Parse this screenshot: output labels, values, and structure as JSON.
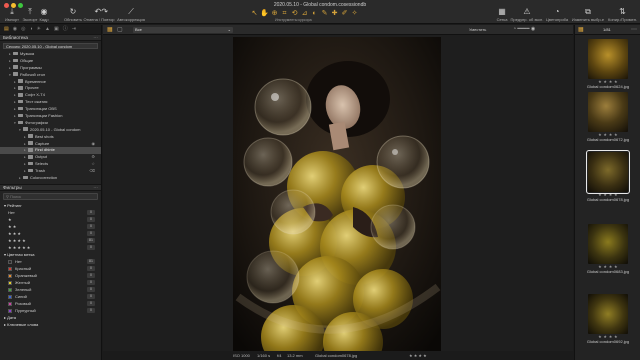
{
  "window": {
    "title": "2020.05.10 - Global condom.cosessiondb"
  },
  "toolbar": {
    "left": [
      {
        "label": "Импорт",
        "icon": "import-icon"
      },
      {
        "label": "Экспорт",
        "icon": "export-icon"
      },
      {
        "label": "Кадр",
        "icon": "camera-icon"
      },
      {
        "label": "Обновить",
        "icon": "refresh-icon"
      },
      {
        "label": "Отмена / Повтор",
        "icon": "undo-icon"
      },
      {
        "label": "Автокоррекция",
        "icon": "magic-wand-icon"
      }
    ],
    "cursor_tools_label": "Инструменты курсора",
    "right": [
      {
        "label": "Сетка",
        "icon": "grid-icon"
      },
      {
        "label": "Предупр. об эксп.",
        "icon": "exposure-warning-icon"
      },
      {
        "label": "Цветопроба",
        "icon": "proof-icon"
      },
      {
        "label": "Изменить выбр-е",
        "icon": "edit-selected-icon"
      },
      {
        "label": "Копир./Примен.",
        "icon": "copy-apply-icon"
      }
    ]
  },
  "left_panel": {
    "library_title": "Библиотека",
    "session_label": "Сессия: 2020.05.10 - Global condom",
    "tree": [
      {
        "label": "Музыка",
        "indent": 1
      },
      {
        "label": "Общие",
        "indent": 1
      },
      {
        "label": "Программы",
        "indent": 1
      },
      {
        "label": "Рабочий стол",
        "indent": 1,
        "open": true
      },
      {
        "label": "Временное",
        "indent": 2
      },
      {
        "label": "Прочее",
        "indent": 2
      },
      {
        "label": "Софт X-T4",
        "indent": 2
      },
      {
        "label": "Тест сжатия",
        "indent": 2
      },
      {
        "label": "Трансляции OBS",
        "indent": 2
      },
      {
        "label": "Трансляции Fashion",
        "indent": 2
      },
      {
        "label": "Фотографии",
        "indent": 2,
        "open": true
      },
      {
        "label": "2020.05.10 - Global condom",
        "indent": 3,
        "open": true
      },
      {
        "label": "Best shots",
        "indent": 4
      },
      {
        "label": "Capture",
        "indent": 4,
        "right_icon": "camera-icon"
      },
      {
        "label": "Find dhinte",
        "indent": 4,
        "selected": true
      },
      {
        "label": "Output",
        "indent": 4,
        "right_icon": "gear-icon"
      },
      {
        "label": "Selects",
        "indent": 4,
        "right_icon": "star-icon"
      },
      {
        "label": "Trash",
        "indent": 4,
        "right_icon": "trash-icon"
      },
      {
        "label": "Colorcorrection",
        "indent": 3
      }
    ],
    "filters_title": "Фильтры",
    "search_placeholder": "Поиск",
    "rating_title": "Рейтинг",
    "ratings": [
      {
        "label": "Нет",
        "count": "0"
      },
      {
        "label": "★",
        "count": "0"
      },
      {
        "label": "★ ★",
        "count": "0"
      },
      {
        "label": "★ ★ ★",
        "count": "0"
      },
      {
        "label": "★ ★ ★ ★",
        "count": "81"
      },
      {
        "label": "★ ★ ★ ★ ★",
        "count": "0"
      }
    ],
    "color_title": "Цветная метка",
    "color_labels": [
      {
        "label": "Нет",
        "count": "81",
        "color": "#2a2a2a"
      },
      {
        "label": "Красный",
        "count": "0",
        "color": "#d43a2f"
      },
      {
        "label": "Оранжевый",
        "count": "0",
        "color": "#e58a2a"
      },
      {
        "label": "Желтый",
        "count": "0",
        "color": "#e4cf2a"
      },
      {
        "label": "Зеленый",
        "count": "0",
        "color": "#3fae3a"
      },
      {
        "label": "Синий",
        "count": "0",
        "color": "#3a64d6"
      },
      {
        "label": "Розовый",
        "count": "0",
        "color": "#d23fa7"
      },
      {
        "label": "Пурпурный",
        "count": "0",
        "color": "#8a3fd0"
      }
    ],
    "date_title": "Дата",
    "keywords_title": "Ключевые слова"
  },
  "viewer": {
    "filter_select": "Все",
    "fit_label": "Уместить",
    "status": {
      "iso": "ISO 1000",
      "shutter": "1/160 s",
      "aperture": "f/4",
      "focal": "13.2 mm",
      "filename": "Global condom0678.jpg",
      "stars": "★ ★ ★ ★"
    }
  },
  "browser": {
    "count": "1/81",
    "thumbs": [
      {
        "name": "Global condom0624.jpg",
        "stars": "★ ★ ★ ★"
      },
      {
        "name": "Global condom0672.jpg",
        "stars": "★ ★ ★ ★"
      },
      {
        "name": "Global condom0678.jpg",
        "stars": "★ ★ ★ ★",
        "selected": true
      },
      {
        "name": "Global condom0683.jpg",
        "stars": "★ ★ ★ ★"
      },
      {
        "name": "Global condom0692.jpg",
        "stars": "★ ★ ★ ★"
      }
    ]
  },
  "colors": {
    "accent": "#e0a83c",
    "panel": "#232323",
    "header": "#2a2a2a"
  }
}
